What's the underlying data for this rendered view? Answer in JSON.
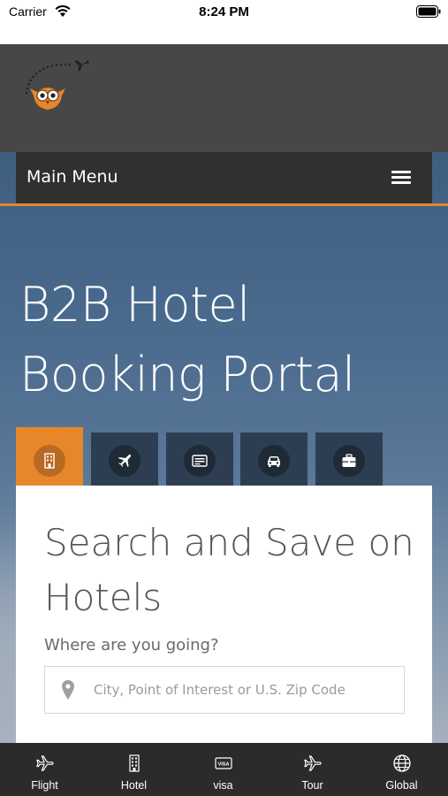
{
  "status_bar": {
    "carrier": "Carrier",
    "time": "8:24 PM"
  },
  "header": {
    "menu_label": "Main Menu"
  },
  "hero": {
    "title": "B2B Hotel Booking Portal"
  },
  "tabs": [
    {
      "icon": "hotel-icon",
      "active": true
    },
    {
      "icon": "flight-icon",
      "active": false
    },
    {
      "icon": "visa-icon",
      "active": false
    },
    {
      "icon": "car-icon",
      "active": false
    },
    {
      "icon": "tour-icon",
      "active": false
    }
  ],
  "search_card": {
    "title": "Search and Save on Hotels",
    "label": "Where are you going?",
    "placeholder": "City, Point of Interest or U.S. Zip Code"
  },
  "bottom_nav": [
    {
      "label": "Flight",
      "icon": "flight-icon"
    },
    {
      "label": "Hotel",
      "icon": "hotel-icon"
    },
    {
      "label": "visa",
      "icon": "visa-icon"
    },
    {
      "label": "Tour",
      "icon": "tour-icon"
    },
    {
      "label": "Global",
      "icon": "globe-icon"
    }
  ],
  "colors": {
    "accent": "#e8862b",
    "header": "#474747",
    "menu_bar": "#303030",
    "tab_inactive": "#2e3e52",
    "bottom_bar": "#2b2b2b"
  }
}
